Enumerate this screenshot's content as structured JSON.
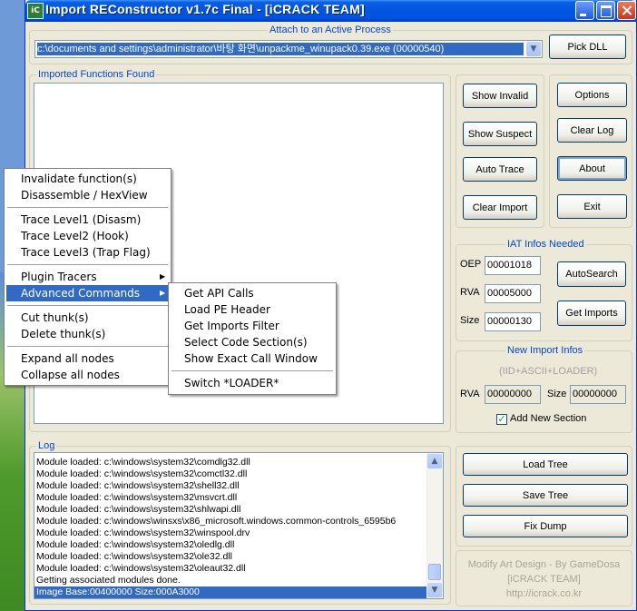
{
  "window": {
    "title": "Import REConstructor v1.7c Final - [iCRACK TEAM]",
    "icon_text": "iC"
  },
  "attach": {
    "label": "Attach to an Active Process",
    "process_value": "c:\\documents and settings\\administrator\\바탕 화면\\unpackme_winupack0.39.exe (00000540)",
    "pick_dll": "Pick DLL"
  },
  "imports": {
    "label": "Imported Functions Found"
  },
  "buttons": {
    "show_invalid": "Show Invalid",
    "show_suspect": "Show Suspect",
    "auto_trace": "Auto Trace",
    "clear_import": "Clear Import",
    "options": "Options",
    "clear_log": "Clear Log",
    "about": "About",
    "exit": "Exit"
  },
  "iat": {
    "label": "IAT Infos Needed",
    "oep_label": "OEP",
    "oep_value": "00001018",
    "rva_label": "RVA",
    "rva_value": "00005000",
    "size_label": "Size",
    "size_value": "00000130",
    "autosearch": "AutoSearch",
    "get_imports": "Get Imports"
  },
  "new_import": {
    "label": "New Import Infos",
    "subtitle": "(IID+ASCII+LOADER)",
    "rva_label": "RVA",
    "rva_value": "00000000",
    "size_label": "Size",
    "size_value": "00000000",
    "add_section_label": "Add New Section",
    "add_section_checked": true
  },
  "log": {
    "label": "Log",
    "lines": [
      "Module loaded: c:\\windows\\system32\\comdlg32.dll",
      "Module loaded: c:\\windows\\system32\\comctl32.dll",
      "Module loaded: c:\\windows\\system32\\shell32.dll",
      "Module loaded: c:\\windows\\system32\\msvcrt.dll",
      "Module loaded: c:\\windows\\system32\\shlwapi.dll",
      "Module loaded: c:\\windows\\winsxs\\x86_microsoft.windows.common-controls_6595b6",
      "Module loaded: c:\\windows\\system32\\winspool.drv",
      "Module loaded: c:\\windows\\system32\\oledlg.dll",
      "Module loaded: c:\\windows\\system32\\ole32.dll",
      "Module loaded: c:\\windows\\system32\\oleaut32.dll",
      "Getting associated modules done.",
      "Image Base:00400000 Size:000A3000"
    ]
  },
  "tree_buttons": {
    "load_tree": "Load Tree",
    "save_tree": "Save Tree",
    "fix_dump": "Fix Dump"
  },
  "credit": {
    "line1": "Modify Art Design - By GameDosa",
    "line2": "[iCRACK TEAM]",
    "line3": "http://icrack.co.kr"
  },
  "context_menu": {
    "items": [
      "Invalidate function(s)",
      "Disassemble / HexView",
      "Trace Level1 (Disasm)",
      "Trace Level2 (Hook)",
      "Trace Level3 (Trap Flag)",
      "Plugin Tracers",
      "Advanced Commands",
      "Cut thunk(s)",
      "Delete thunk(s)",
      "Expand all nodes",
      "Collapse all nodes"
    ]
  },
  "submenu": {
    "items": [
      "Get API Calls",
      "Load PE Header",
      "Get Imports Filter",
      "Select Code Section(s)",
      "Show Exact Call Window",
      "Switch *LOADER*"
    ]
  },
  "colors": {
    "title_blue": "#0054e3",
    "selection": "#316ac5",
    "group_label": "#0046d5",
    "window_bg": "#ece9d8"
  }
}
